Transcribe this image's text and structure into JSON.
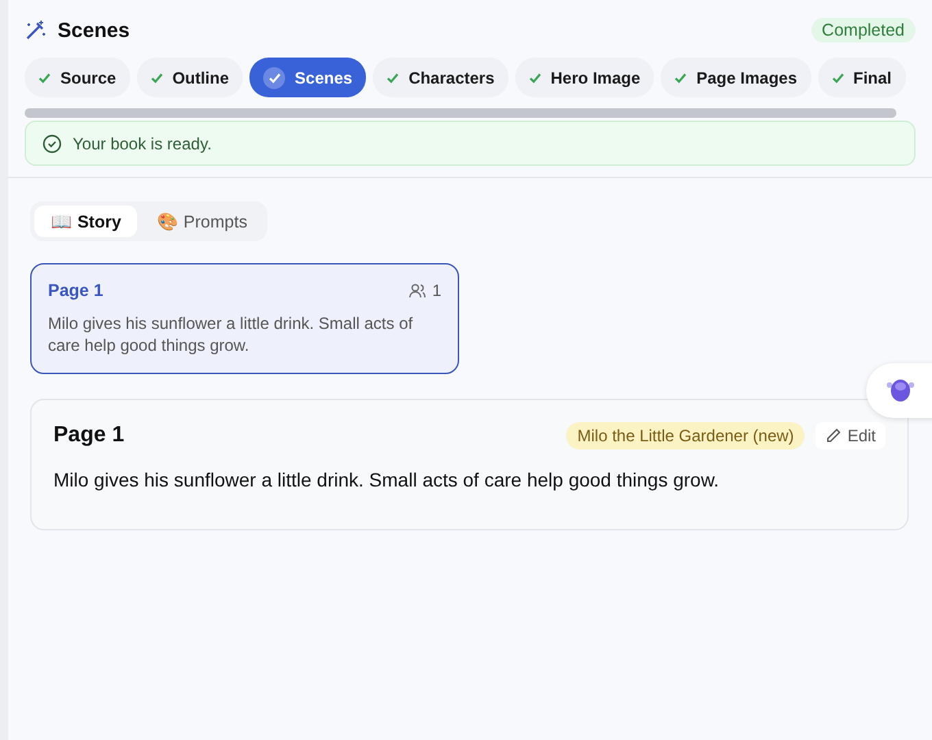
{
  "header": {
    "title": "Scenes",
    "status": "Completed"
  },
  "steps": [
    {
      "label": "Source",
      "done": true,
      "selected": false
    },
    {
      "label": "Outline",
      "done": true,
      "selected": false
    },
    {
      "label": "Scenes",
      "done": true,
      "selected": true
    },
    {
      "label": "Characters",
      "done": true,
      "selected": false
    },
    {
      "label": "Hero Image",
      "done": true,
      "selected": false
    },
    {
      "label": "Page Images",
      "done": true,
      "selected": false
    },
    {
      "label": "Final",
      "done": true,
      "selected": false
    }
  ],
  "alert": {
    "text": "Your book is ready."
  },
  "view_tabs": [
    {
      "icon": "📖",
      "label": "Story",
      "selected": true
    },
    {
      "icon": "🎨",
      "label": "Prompts",
      "selected": false
    }
  ],
  "pages": [
    {
      "title": "Page 1",
      "count": "1",
      "text": "Milo gives his sunflower a little drink. Small acts of care help good things grow.",
      "selected": true
    }
  ],
  "detail": {
    "title": "Page 1",
    "character": "Milo the Little Gardener (new)",
    "edit": "Edit",
    "text": "Milo gives his sunflower a little drink. Small acts of care help good things grow."
  }
}
